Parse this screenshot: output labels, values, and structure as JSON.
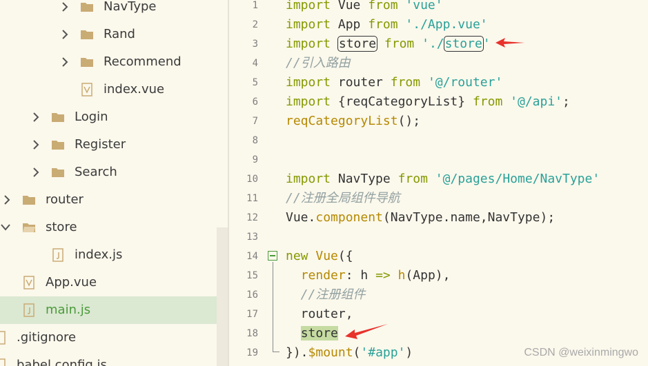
{
  "explorer": {
    "items": [
      {
        "label": "NavType",
        "kind": "folder",
        "expanded": false
      },
      {
        "label": "Rand",
        "kind": "folder",
        "expanded": false
      },
      {
        "label": "Recommend",
        "kind": "folder",
        "expanded": false
      },
      {
        "label": "index.vue",
        "kind": "vue-file"
      },
      {
        "label": "Login",
        "kind": "folder",
        "expanded": false
      },
      {
        "label": "Register",
        "kind": "folder",
        "expanded": false
      },
      {
        "label": "Search",
        "kind": "folder",
        "expanded": false
      },
      {
        "label": "router",
        "kind": "folder",
        "expanded": false
      },
      {
        "label": "store",
        "kind": "folder",
        "expanded": true
      },
      {
        "label": "index.js",
        "kind": "js-file"
      },
      {
        "label": "App.vue",
        "kind": "vue-file"
      },
      {
        "label": "main.js",
        "kind": "js-file",
        "selected": true
      },
      {
        "label": ".gitignore",
        "kind": "file"
      },
      {
        "label": "babel.config.js",
        "kind": "file"
      }
    ]
  },
  "editor": {
    "line_numbers": [
      "1",
      "2",
      "3",
      "4",
      "5",
      "6",
      "7",
      "8",
      "9",
      "10",
      "11",
      "12",
      "13",
      "14",
      "15",
      "16",
      "17",
      "18",
      "19"
    ]
  },
  "colors": {
    "background": "#fbf8ec",
    "keyword": "#859900",
    "string": "#2aa198",
    "comment": "#93a1a1",
    "function": "#b58900",
    "selection": "#dbe8d2",
    "highlight": "#c5dba1",
    "arrow": "#e8322c"
  },
  "watermark": "CSDN @weixinmingwo"
}
